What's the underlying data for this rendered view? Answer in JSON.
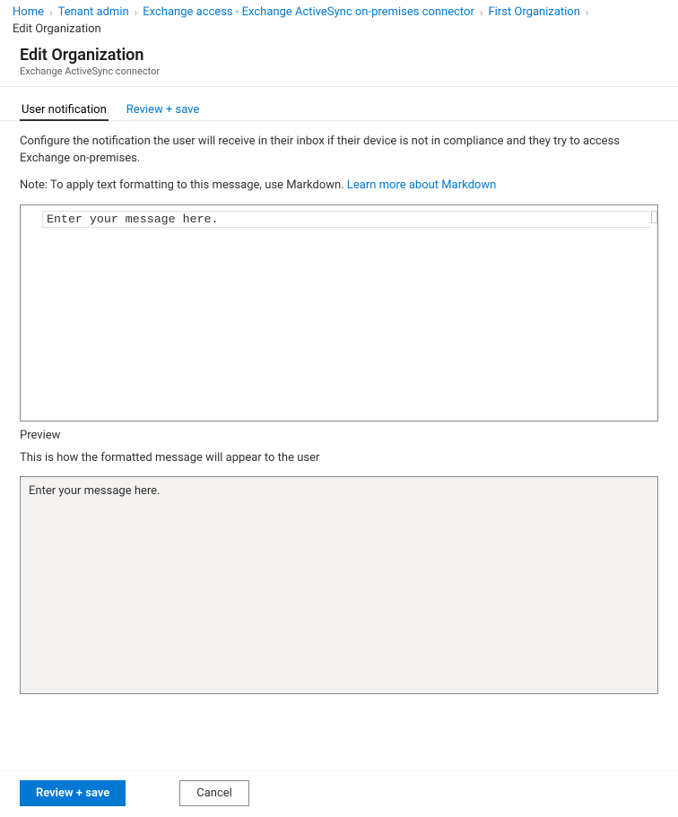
{
  "breadcrumb": {
    "items": [
      {
        "label": "Home",
        "link": true
      },
      {
        "label": "Tenant admin",
        "link": true
      },
      {
        "label": "Exchange access - Exchange ActiveSync on-premises connector",
        "link": true
      },
      {
        "label": "First Organization",
        "link": true
      },
      {
        "label": "Edit Organization",
        "link": false
      }
    ]
  },
  "header": {
    "title": "Edit Organization",
    "subtitle": "Exchange ActiveSync connector"
  },
  "tabs": [
    {
      "label": "User notification",
      "active": true
    },
    {
      "label": "Review + save",
      "active": false
    }
  ],
  "main": {
    "description": "Configure the notification the user will receive in their inbox if their device is not in compliance and they try to access Exchange on-premises.",
    "note_prefix": "Note: To apply text formatting to this message, use Markdown. ",
    "note_link": "Learn more about Markdown",
    "editor_text": "Enter your message here.",
    "preview_label": "Preview",
    "preview_subtitle": "This is how the formatted message will appear to the user",
    "preview_text": "Enter your message here."
  },
  "footer": {
    "primary_label": "Review + save",
    "secondary_label": "Cancel"
  }
}
